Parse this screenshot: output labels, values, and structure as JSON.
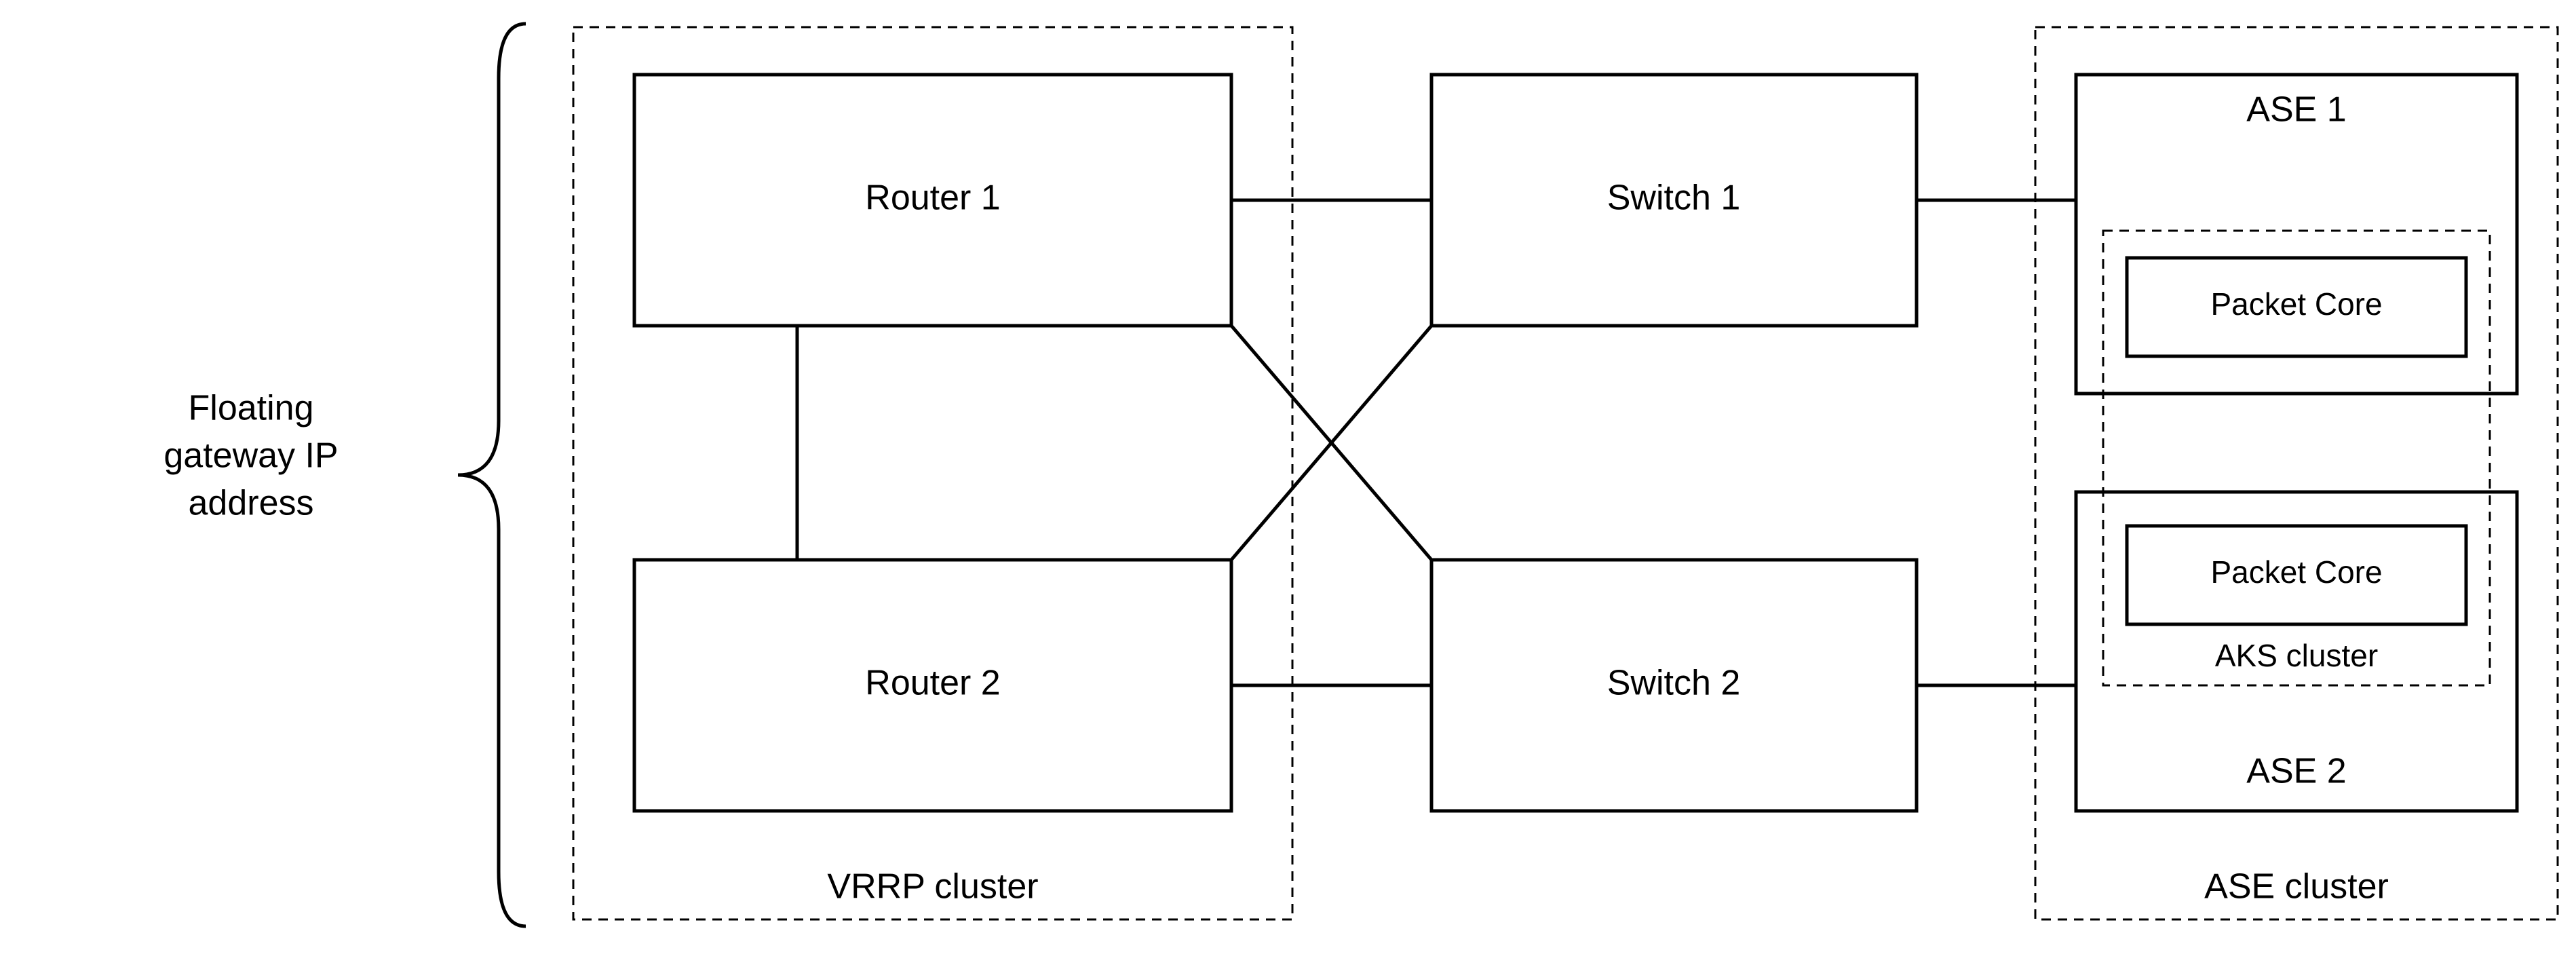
{
  "side_label": {
    "line1": "Floating",
    "line2": "gateway IP",
    "line3": "address"
  },
  "vrrp": {
    "router1": "Router 1",
    "router2": "Router 2",
    "cluster_label": "VRRP cluster"
  },
  "switches": {
    "switch1": "Switch 1",
    "switch2": "Switch 2"
  },
  "ase": {
    "ase1": "ASE 1",
    "ase2": "ASE 2",
    "packet_core1": "Packet Core",
    "packet_core2": "Packet Core",
    "aks_label": "AKS cluster",
    "cluster_label": "ASE cluster"
  }
}
